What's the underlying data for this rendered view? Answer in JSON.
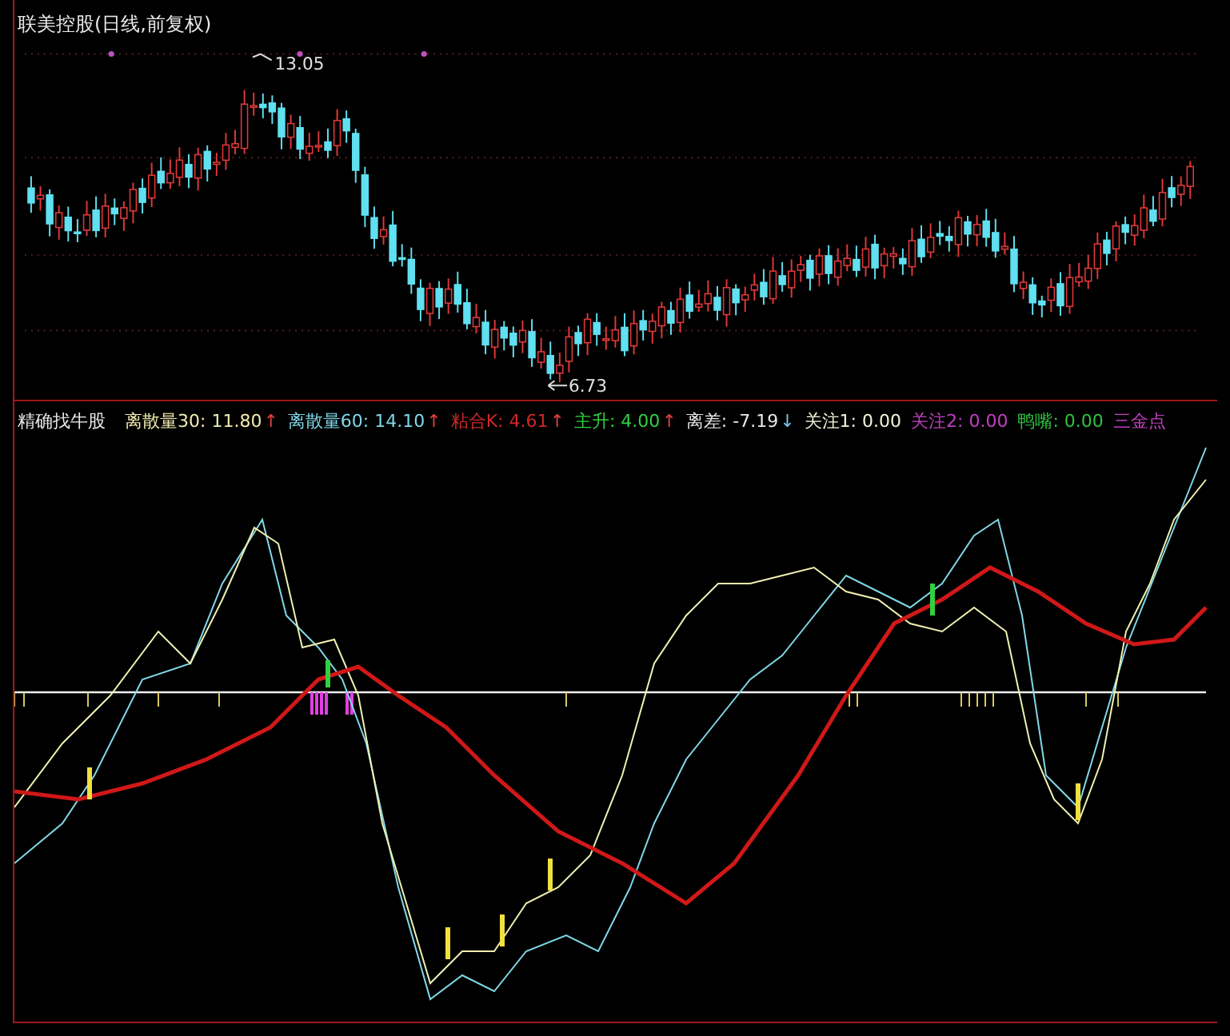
{
  "stock_panel": {
    "title": "联美控股(日线,前复权)",
    "high_label": "13.05",
    "low_label": "6.73"
  },
  "indicator_panel": {
    "name": "精确找牛股",
    "readings": [
      {
        "kind": "rising",
        "text": "离散量30: 11.80",
        "color": "#f0ecb0",
        "arrow": "↑"
      },
      {
        "kind": "rising",
        "text": "离散量60: 14.10",
        "color": "#7fd8e8",
        "arrow": "↑"
      },
      {
        "kind": "rising",
        "text": "粘合K: 4.61",
        "color": "#d02828",
        "arrow": "↑"
      },
      {
        "kind": "rising",
        "text": "主升: 4.00",
        "color": "#30d040",
        "arrow": "↑"
      },
      {
        "kind": "falling",
        "text": "离差: -7.19",
        "color": "#e8e8e8",
        "arrow": "↓"
      },
      {
        "text": "关注1: 0.00",
        "color": "#f4f4d8"
      },
      {
        "text": "关注2: 0.00",
        "color": "#c040c0"
      },
      {
        "text": "鸭嘴: 0.00",
        "color": "#30c040"
      },
      {
        "text": "三金点",
        "color": "#c040c0"
      }
    ]
  }
}
